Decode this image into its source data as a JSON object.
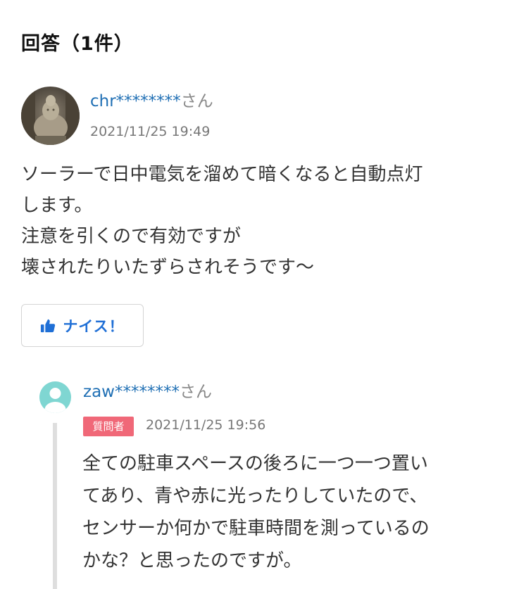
{
  "heading": "回答（1件）",
  "answer": {
    "username": "chr********",
    "suffix": "さん",
    "timestamp": "2021/11/25 19:49",
    "body_lines": [
      "ソーラーで日中電気を溜めて暗くなると自動点灯",
      "します。",
      "注意を引くので有効ですが",
      "壊されたりいたずらされそうです～"
    ],
    "nice_label": "ナイス！"
  },
  "reply": {
    "username": "zaw********",
    "suffix": "さん",
    "badge": "質問者",
    "timestamp": "2021/11/25 19:56",
    "body_lines": [
      "全ての駐車スペースの後ろに一つ一つ置い",
      "てあり、青や赤に光ったりしていたので、",
      "センサーか何かで駐車時間を測っているの",
      "かな？と思ったのですが。"
    ]
  },
  "colors": {
    "username": "#1f6fb4",
    "nice_accent": "#1f6fd6",
    "badge_bg": "#f06878",
    "reply_avatar": "#7fd6d2"
  },
  "icons": {
    "answer_avatar": "buddha-statue-avatar",
    "reply_avatar": "default-user-avatar",
    "nice": "thumbs-up-icon"
  }
}
